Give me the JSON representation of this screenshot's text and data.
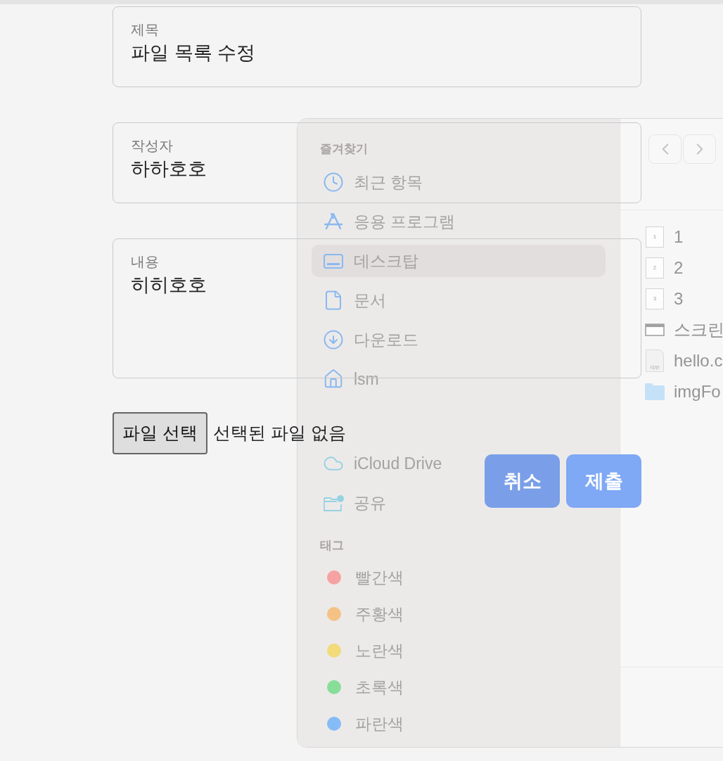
{
  "form": {
    "fields": [
      {
        "kind": "input",
        "label": "제목",
        "value": "파일 목록 수정"
      },
      {
        "kind": "input",
        "label": "작성자",
        "value": "하하호호"
      },
      {
        "kind": "textarea",
        "label": "내용",
        "value": "히히호호"
      }
    ],
    "file_button": "파일 선택",
    "file_status": "선택된 파일 없음",
    "buttons": [
      {
        "label": "취소"
      },
      {
        "label": "제출"
      }
    ]
  },
  "dialog": {
    "sections": [
      {
        "header": "즐겨찾기",
        "items": [
          {
            "kind": "clock",
            "label": "최근 항목",
            "selected": false
          },
          {
            "kind": "apps",
            "label": "응용 프로그램",
            "selected": false
          },
          {
            "kind": "desktop",
            "label": "데스크탑",
            "selected": true
          },
          {
            "kind": "document",
            "label": "문서",
            "selected": false
          },
          {
            "kind": "download",
            "label": "다운로드",
            "selected": false
          },
          {
            "kind": "home",
            "label": "lsm",
            "selected": false
          }
        ]
      },
      {
        "items": [
          {
            "kind": "cloud",
            "label": "iCloud Drive",
            "selected": false
          },
          {
            "kind": "shared",
            "label": "공유",
            "selected": false
          }
        ]
      }
    ],
    "tags_header": "태그",
    "tags": [
      {
        "label": "빨간색",
        "color": "#f79a9a"
      },
      {
        "label": "주황색",
        "color": "#f5bd78"
      },
      {
        "label": "노란색",
        "color": "#f3d86f"
      },
      {
        "label": "초록색",
        "color": "#7ddc90"
      },
      {
        "label": "파란색",
        "color": "#79b6f7"
      }
    ],
    "files": [
      {
        "kind": "page",
        "thumb": "1",
        "name": "1"
      },
      {
        "kind": "page",
        "thumb": "2",
        "name": "2"
      },
      {
        "kind": "page",
        "thumb": "3",
        "name": "3"
      },
      {
        "kind": "screenshot",
        "name": "스크린"
      },
      {
        "kind": "cpp",
        "thumb": "cpp",
        "name": "hello.c"
      },
      {
        "kind": "folder",
        "name": "imgFo"
      }
    ]
  }
}
